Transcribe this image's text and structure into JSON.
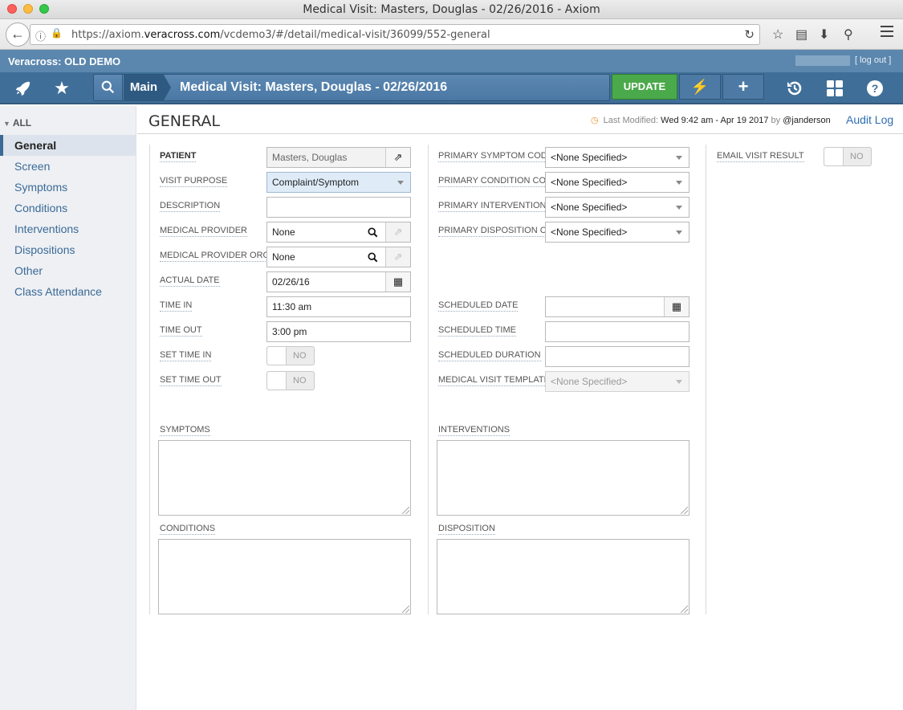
{
  "window": {
    "title": "Medical Visit: Masters, Douglas - 02/26/2016 - Axiom"
  },
  "browser": {
    "url_prefix": "https://axiom.",
    "url_domain": "veracross.com",
    "url_path": "/vcdemo3/#/detail/medical-visit/36099/552-general"
  },
  "app": {
    "school_name": "Veracross: OLD DEMO",
    "logout_label": "[ log out ]",
    "breadcrumb_main": "Main",
    "page_heading": "Medical Visit: Masters, Douglas - 02/26/2016",
    "update_label": "UPDATE",
    "plus_label": "+"
  },
  "sidebar": {
    "all_label": "ALL",
    "items": [
      {
        "label": "General",
        "active": true
      },
      {
        "label": "Screen"
      },
      {
        "label": "Symptoms"
      },
      {
        "label": "Conditions"
      },
      {
        "label": "Interventions"
      },
      {
        "label": "Dispositions"
      },
      {
        "label": "Other"
      },
      {
        "label": "Class Attendance"
      }
    ]
  },
  "section": {
    "title": "GENERAL",
    "last_modified_label": "Last Modified:",
    "last_modified_value": "Wed 9:42 am - Apr 19 2017",
    "by_label": "by",
    "by_user": "@janderson",
    "audit_log": "Audit Log"
  },
  "form": {
    "left": {
      "patient": {
        "label": "PATIENT",
        "value": "Masters, Douglas"
      },
      "visit_purpose": {
        "label": "VISIT PURPOSE",
        "value": "Complaint/Symptom"
      },
      "description": {
        "label": "DESCRIPTION",
        "value": ""
      },
      "medical_provider": {
        "label": "MEDICAL PROVIDER",
        "value": "None"
      },
      "medical_provider_org": {
        "label": "MEDICAL PROVIDER ORG...",
        "value": "None"
      },
      "actual_date": {
        "label": "ACTUAL DATE",
        "value": "02/26/16"
      },
      "time_in": {
        "label": "TIME IN",
        "value": "11:30 am"
      },
      "time_out": {
        "label": "TIME OUT",
        "value": "3:00 pm"
      },
      "set_time_in": {
        "label": "SET TIME IN",
        "value": "NO"
      },
      "set_time_out": {
        "label": "SET TIME OUT",
        "value": "NO"
      },
      "symptoms": {
        "label": "SYMPTOMS"
      },
      "conditions": {
        "label": "CONDITIONS"
      }
    },
    "middle": {
      "primary_symptom_code": {
        "label": "PRIMARY SYMPTOM CODE",
        "value": "<None Specified>"
      },
      "primary_condition_code": {
        "label": "PRIMARY CONDITION CODE",
        "value": "<None Specified>"
      },
      "primary_intervention": {
        "label": "PRIMARY INTERVENTION ...",
        "value": "<None Specified>"
      },
      "primary_disposition": {
        "label": "PRIMARY DISPOSITION C...",
        "value": "<None Specified>"
      },
      "scheduled_date": {
        "label": "SCHEDULED DATE",
        "value": ""
      },
      "scheduled_time": {
        "label": "SCHEDULED TIME",
        "value": ""
      },
      "scheduled_duration": {
        "label": "SCHEDULED DURATION",
        "value": ""
      },
      "medical_visit_template": {
        "label": "MEDICAL VISIT TEMPLATE",
        "value": "<None Specified>"
      },
      "interventions": {
        "label": "INTERVENTIONS"
      },
      "disposition": {
        "label": "DISPOSITION"
      }
    },
    "right": {
      "email_visit_result": {
        "label": "EMAIL VISIT RESULT",
        "value": "NO"
      }
    }
  }
}
